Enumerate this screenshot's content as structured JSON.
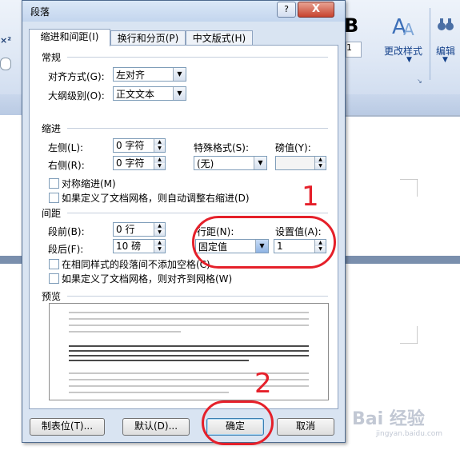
{
  "dialog": {
    "title": "段落",
    "help_label": "?",
    "close_label": "X",
    "tabs": [
      {
        "label": "缩进和间距(I)"
      },
      {
        "label": "换行和分页(P)"
      },
      {
        "label": "中文版式(H)"
      }
    ],
    "general": {
      "heading": "常规",
      "alignment_label": "对齐方式(G):",
      "alignment_value": "左对齐",
      "outline_label": "大纲级别(O):",
      "outline_value": "正文文本"
    },
    "indent": {
      "heading": "缩进",
      "left_label": "左侧(L):",
      "left_value": "0 字符",
      "right_label": "右侧(R):",
      "right_value": "0 字符",
      "special_label": "特殊格式(S):",
      "special_value": "(无)",
      "by_label": "磅值(Y):",
      "by_value": "",
      "mirror_label": "对称缩进(M)",
      "auto_adjust_label": "如果定义了文档网格，则自动调整右缩进(D)"
    },
    "spacing": {
      "heading": "间距",
      "before_label": "段前(B):",
      "before_value": "0 行",
      "after_label": "段后(F):",
      "after_value": "10 磅",
      "line_label": "行距(N):",
      "line_value": "固定值",
      "at_label": "设置值(A):",
      "at_value": "1",
      "no_space_label": "在相同样式的段落间不添加空格(C)",
      "snap_grid_label": "如果定义了文档网格，则对齐到网格(W)"
    },
    "preview": {
      "heading": "预览"
    },
    "buttons": {
      "tabs": "制表位(T)...",
      "default": "默认(D)...",
      "ok": "确定",
      "cancel": "取消"
    }
  },
  "ribbon": {
    "bold_glyph": "B",
    "styles_label": "更改样式",
    "edit_label": "编辑",
    "size_value": "1"
  },
  "annotations": {
    "num1": "1",
    "num2": "2"
  },
  "watermark": {
    "text": "Bai 经验",
    "url": "jingyan.baidu.com"
  },
  "colors": {
    "annotation_red": "#e5202a",
    "dialog_bg": "#d9e4f2"
  }
}
